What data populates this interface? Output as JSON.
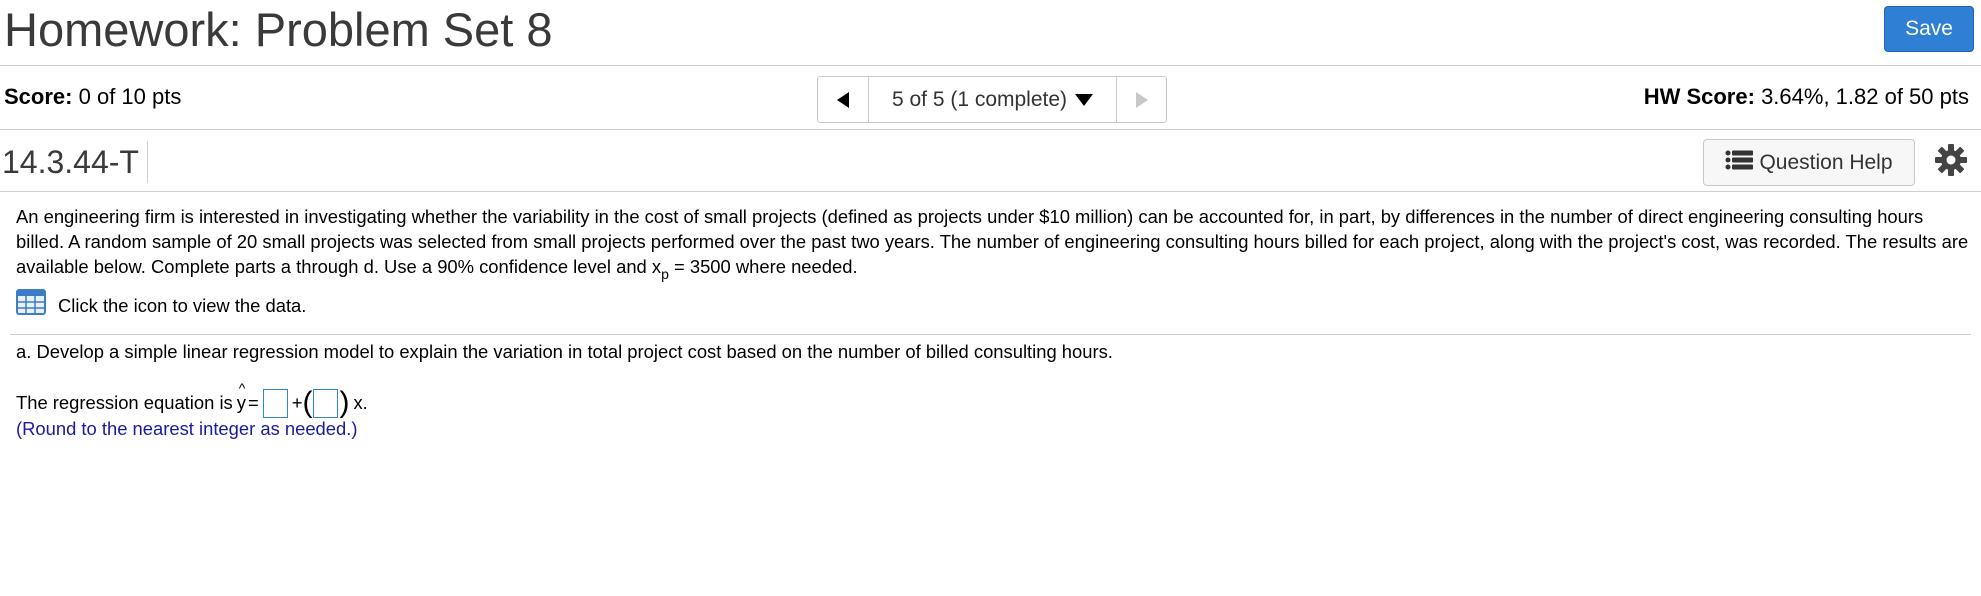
{
  "header": {
    "title": "Homework: Problem Set 8",
    "save_label": "Save"
  },
  "scorebar": {
    "score_label": "Score:",
    "score_value": "0 of 10 pts",
    "nav_position": "5 of 5 (1 complete)",
    "hw_score_label": "HW Score:",
    "hw_score_value": "3.64%, 1.82 of 50 pts"
  },
  "question": {
    "id": "14.3.44-T",
    "help_label": "Question Help",
    "intro_part1": "An engineering firm is interested in investigating whether the variability in the cost of small projects (defined as projects under $10 million) can be accounted for, in part, by differences in the number of direct engineering consulting hours billed. A random sample of 20 small projects was selected from small projects performed over the past two years. The number of engineering consulting hours billed for each project, along with the project's cost, was recorded. The results are available below. Complete parts a through d. Use a 90% confidence level and x",
    "intro_sub": "p",
    "intro_part2": " = 3500 where needed.",
    "data_link": "Click the icon to view the data.",
    "part_a": "a. Develop a simple linear regression model to explain the variation in total project cost based on the number of billed consulting hours.",
    "equation_prefix": "The regression equation is",
    "y_symbol": "y",
    "equals": "=",
    "plus": "+",
    "x_suffix": "x.",
    "hint": "(Round to the nearest integer as needed.)"
  },
  "colors": {
    "save_button": "#2f7fd4",
    "answer_box_border": "#2f88c9",
    "hint_text": "#1a1aa0"
  },
  "icons": [
    "chevron-left-icon",
    "caret-down-icon",
    "chevron-right-icon",
    "list-icon",
    "gear-icon",
    "data-table-icon"
  ]
}
